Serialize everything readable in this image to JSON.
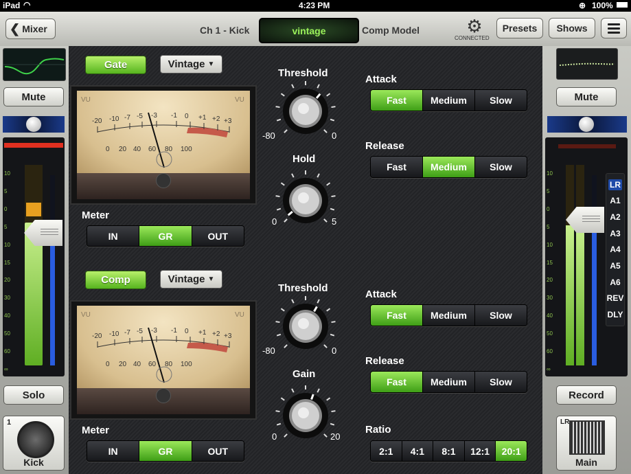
{
  "status_bar": {
    "device": "iPad",
    "time": "4:23 PM",
    "battery": "100%"
  },
  "nav": {
    "back_label": "Mixer",
    "channel": "Ch 1 - Kick",
    "model_value": "vintage",
    "model_label": "Comp Model",
    "connected": "CONNECTED",
    "presets": "Presets",
    "shows": "Shows"
  },
  "left_strip": {
    "mute": "Mute",
    "solo": "Solo",
    "channel_num": "1",
    "channel_name": "Kick",
    "fader_scale": [
      "10",
      "5",
      "0",
      "5",
      "10",
      "15",
      "20",
      "30",
      "40",
      "50",
      "60",
      "∞"
    ]
  },
  "right_strip": {
    "mute": "Mute",
    "record": "Record",
    "main_label": "Main",
    "main_tag": "LR",
    "buses": [
      "LR",
      "A1",
      "A2",
      "A3",
      "A4",
      "A5",
      "A6",
      "REV",
      "DLY"
    ],
    "fader_scale": [
      "10",
      "5",
      "0",
      "5",
      "10",
      "15",
      "20",
      "30",
      "40",
      "50",
      "60",
      "∞"
    ]
  },
  "gate": {
    "toggle": "Gate",
    "model": "Vintage",
    "vu_scale": [
      "VU",
      "-20",
      "-10",
      "-7",
      "-5",
      "-3",
      "-1",
      "0",
      "+1",
      "+2",
      "+3",
      "0",
      "20",
      "40",
      "60",
      "80",
      "100",
      "VU"
    ],
    "meter_label": "Meter",
    "meter_options": [
      "IN",
      "GR",
      "OUT"
    ],
    "meter_selected": "GR",
    "threshold": {
      "label": "Threshold",
      "min": "-80",
      "max": "0"
    },
    "hold": {
      "label": "Hold",
      "min": "0",
      "max": "5"
    },
    "attack": {
      "label": "Attack",
      "options": [
        "Fast",
        "Medium",
        "Slow"
      ],
      "selected": "Fast"
    },
    "release": {
      "label": "Release",
      "options": [
        "Fast",
        "Medium",
        "Slow"
      ],
      "selected": "Medium"
    }
  },
  "comp": {
    "toggle": "Comp",
    "model": "Vintage",
    "vu_scale": [
      "VU",
      "-20",
      "-10",
      "-7",
      "-5",
      "-3",
      "-1",
      "0",
      "+1",
      "+2",
      "+3",
      "0",
      "20",
      "40",
      "60",
      "80",
      "100",
      "VU"
    ],
    "meter_label": "Meter",
    "meter_options": [
      "IN",
      "GR",
      "OUT"
    ],
    "meter_selected": "GR",
    "threshold": {
      "label": "Threshold",
      "min": "-80",
      "max": "0"
    },
    "gain": {
      "label": "Gain",
      "min": "0",
      "max": "20"
    },
    "attack": {
      "label": "Attack",
      "options": [
        "Fast",
        "Medium",
        "Slow"
      ],
      "selected": "Fast"
    },
    "release": {
      "label": "Release",
      "options": [
        "Fast",
        "Medium",
        "Slow"
      ],
      "selected": "Fast"
    },
    "ratio": {
      "label": "Ratio",
      "options": [
        "2:1",
        "4:1",
        "8:1",
        "12:1",
        "20:1"
      ],
      "selected": "20:1"
    }
  },
  "colors": {
    "accent_green": "#56b41e",
    "meter_red": "#e03020",
    "meter_yellow": "#e8a020",
    "bus_highlight": "#1f4aa8"
  }
}
